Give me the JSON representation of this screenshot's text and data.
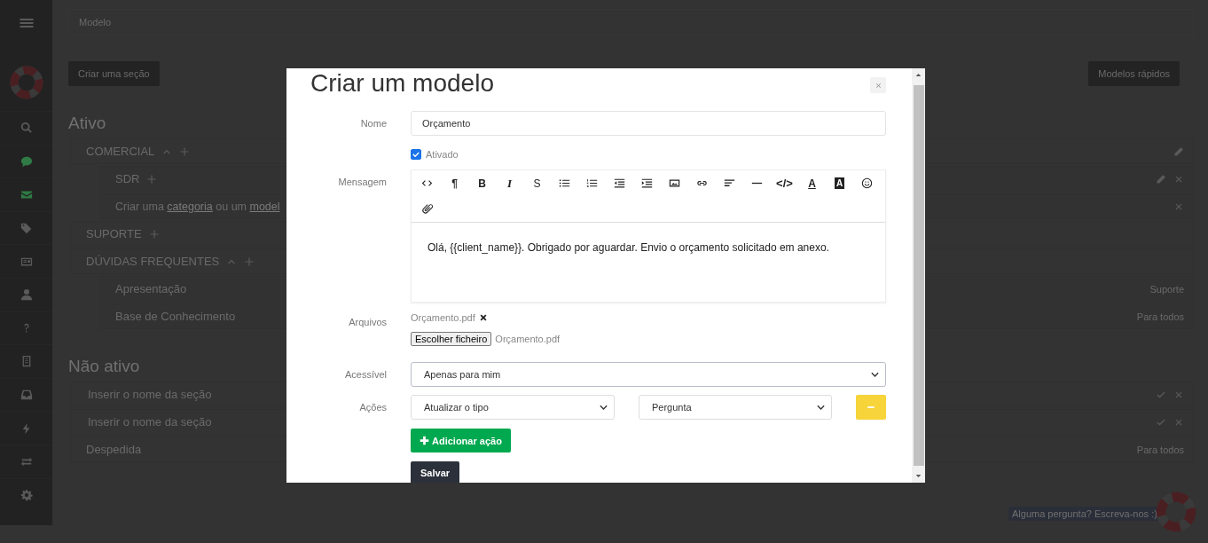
{
  "page": {
    "breadcrumb": "Modelo",
    "create_section_button": "Criar uma seção",
    "quick_templates_button": "Modelos rápidos",
    "sections": [
      {
        "title": "Ativo",
        "rows": [
          {
            "kind": "group",
            "label": "COMERCIAL",
            "expanded": true,
            "editable": true,
            "children": [
              {
                "kind": "category",
                "label": "SDR"
              },
              {
                "kind": "hint",
                "text_1": "Criar uma",
                "link_1": "categoria",
                "text_2": "ou um",
                "link_2": "model"
              }
            ]
          },
          {
            "kind": "group",
            "label": "SUPORTE",
            "editable": false
          },
          {
            "kind": "group",
            "label": "DÚVIDAS FREQUENTES",
            "expanded": true,
            "editable": false,
            "children": [
              {
                "kind": "template",
                "label": "Apresentação",
                "audience": "Suporte"
              },
              {
                "kind": "template",
                "label": "Base de Conhecimento",
                "audience": "Para todos"
              }
            ]
          }
        ]
      },
      {
        "title": "Não ativo",
        "rows": [
          {
            "kind": "new",
            "placeholder": "Inserir o nome da seção"
          },
          {
            "kind": "new",
            "placeholder": "Inserir o nome da seção"
          },
          {
            "kind": "template",
            "label": "Despedida",
            "audience": "Para todos"
          }
        ]
      }
    ],
    "help_chip": "Alguma pergunta? Escreva-nos :)"
  },
  "modal": {
    "title": "Criar um modelo",
    "name": {
      "label": "Nome",
      "value": "Orçamento"
    },
    "enabled": {
      "label": "Ativado",
      "checked": true
    },
    "message": {
      "label": "Mensagem",
      "toolbar": [
        {
          "kind": "code-view"
        },
        {
          "kind": "paragraph",
          "label": "¶"
        },
        {
          "kind": "bold",
          "label": "B"
        },
        {
          "kind": "italic",
          "label": "I"
        },
        {
          "kind": "strikethrough",
          "label": "S"
        },
        {
          "kind": "bullet-list"
        },
        {
          "kind": "numbered-list"
        },
        {
          "kind": "outdent"
        },
        {
          "kind": "indent"
        },
        {
          "kind": "image"
        },
        {
          "kind": "link"
        },
        {
          "kind": "align"
        },
        {
          "kind": "horizontal-rule"
        },
        {
          "kind": "code",
          "label": "</>"
        },
        {
          "kind": "text-color",
          "label": "A"
        },
        {
          "kind": "highlight",
          "label": "A"
        },
        {
          "kind": "emoji"
        },
        {
          "kind": "attachment"
        }
      ],
      "text": "Olá, {{client_name}}. Obrigado por aguardar. Envio o orçamento solicitado em anexo."
    },
    "files": {
      "label": "Arquivos",
      "attached": [
        {
          "name": "Orçamento.pdf"
        }
      ],
      "button": "Escolher ficheiro",
      "chosen": "Orçamento.pdf"
    },
    "access": {
      "label": "Acessível",
      "value": "Apenas para mim"
    },
    "actions": {
      "label": "Ações",
      "rows": [
        {
          "action": "Atualizar o tipo",
          "value": "Pergunta"
        }
      ]
    },
    "add_button": "Adicionar ação",
    "save_button": "Salvar"
  }
}
